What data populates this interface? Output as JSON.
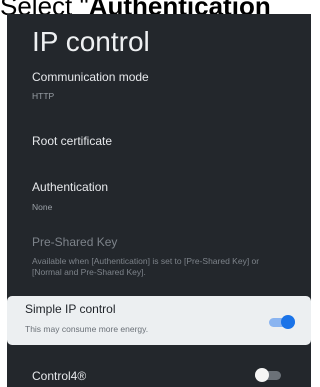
{
  "instruction": {
    "prefix": "Select \"",
    "bold": "Authentication"
  },
  "screen": {
    "title": "IP control"
  },
  "settings": [
    {
      "label": "Communication mode",
      "value": "HTTP"
    },
    {
      "label": "Root certificate"
    },
    {
      "label": "Authentication",
      "value": "None"
    },
    {
      "label": "Pre-Shared Key",
      "value": "Available when [Authentication] is set to [Pre-Shared Key] or [Normal and Pre-Shared Key]."
    },
    {
      "label": "Simple IP control",
      "value": "This may consume more energy.",
      "toggle": "on"
    },
    {
      "label": "Control4®",
      "toggle": "off"
    }
  ],
  "colors": {
    "panel_background": "#23272c",
    "focused_card": "#eceff1",
    "toggle_on": "#1a73e8"
  }
}
